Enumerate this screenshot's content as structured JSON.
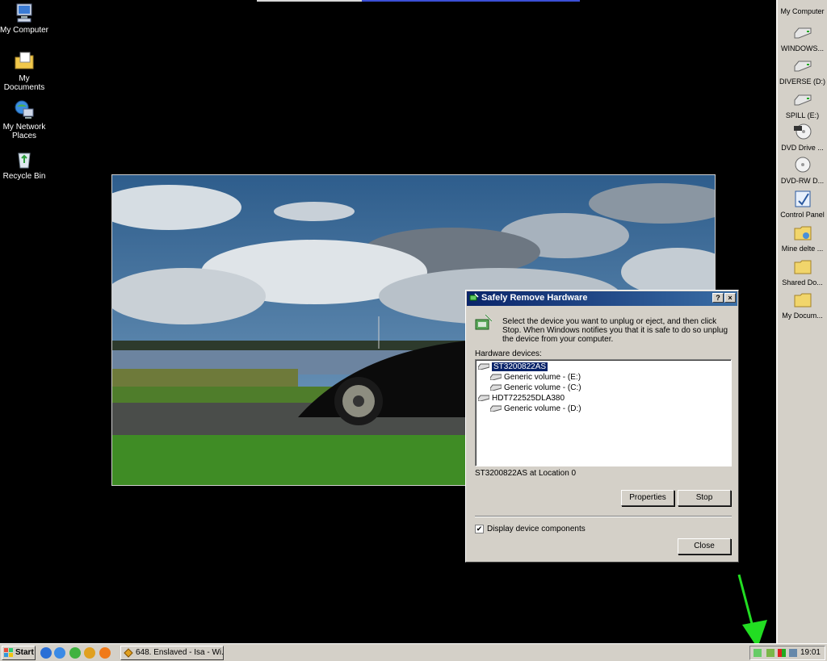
{
  "desktop_icons": [
    {
      "label": "My Computer",
      "icon": "my-computer-icon"
    },
    {
      "label": "My Documents",
      "icon": "my-documents-icon"
    },
    {
      "label": "My Network Places",
      "icon": "network-places-icon"
    },
    {
      "label": "Recycle Bin",
      "icon": "recycle-bin-icon"
    }
  ],
  "right_toolbar": {
    "title": "My Computer",
    "items": [
      {
        "label": "WINDOWS...",
        "icon": "drive-icon"
      },
      {
        "label": "DIVERSE (D:)",
        "icon": "drive-icon"
      },
      {
        "label": "SPILL (E:)",
        "icon": "drive-icon"
      },
      {
        "label": "DVD Drive ...",
        "icon": "dvd-drive-icon"
      },
      {
        "label": "DVD-RW D...",
        "icon": "cd-drive-icon"
      },
      {
        "label": "Control Panel",
        "icon": "control-panel-icon"
      },
      {
        "label": "Mine delte ...",
        "icon": "shared-folder-icon"
      },
      {
        "label": "Shared Do...",
        "icon": "folder-icon"
      },
      {
        "label": "My Docum...",
        "icon": "folder-icon"
      }
    ]
  },
  "dialog": {
    "title": "Safely Remove Hardware",
    "help_button": "?",
    "close_button": "×",
    "intro": "Select the device you want to unplug or eject, and then click Stop. When Windows notifies you that it is safe to do so unplug the device from your computer.",
    "hardware_label": "Hardware devices:",
    "tree": [
      {
        "label": "ST3200822AS",
        "level": 0,
        "selected": true
      },
      {
        "label": "Generic volume - (E:)",
        "level": 1,
        "selected": false
      },
      {
        "label": "Generic volume - (C:)",
        "level": 1,
        "selected": false
      },
      {
        "label": "HDT722525DLA380",
        "level": 0,
        "selected": false
      },
      {
        "label": "Generic volume - (D:)",
        "level": 1,
        "selected": false
      }
    ],
    "status": "ST3200822AS at Location 0",
    "properties_button": "Properties",
    "stop_button": "Stop",
    "display_components_label": "Display device components",
    "display_components_checked": true,
    "checkmark": "✔",
    "close_label": "Close"
  },
  "taskbar": {
    "start_label": "Start",
    "quick_launch": [
      "ie-icon",
      "outlook-icon",
      "media-icon",
      "winamp-icon",
      "firefox-icon"
    ],
    "task_label": "648. Enslaved - Isa - Wi...",
    "clock": "19:01"
  },
  "colors": {
    "desktop": "#000000",
    "title_bar_start": "#0a246a",
    "title_bar_end": "#3a6ea5",
    "face": "#d4d0c8",
    "arrow": "#22dd22"
  }
}
